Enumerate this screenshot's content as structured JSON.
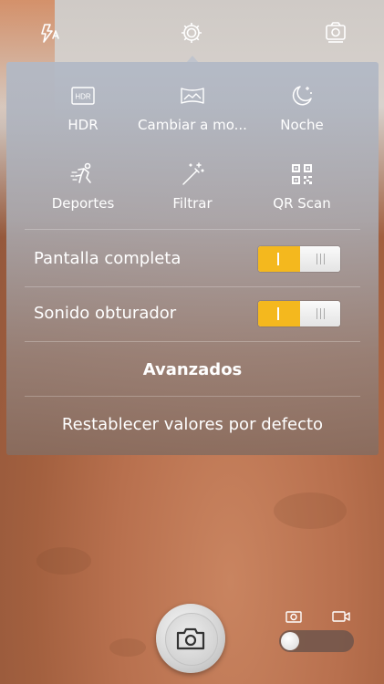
{
  "topbar": {
    "flash_icon": "flash-auto-icon",
    "settings_icon": "gear-icon",
    "switch_camera_icon": "switch-camera-icon"
  },
  "modes": [
    {
      "label": "HDR",
      "icon": "hdr-icon"
    },
    {
      "label": "Cambiar a mo...",
      "icon": "panorama-icon"
    },
    {
      "label": "Noche",
      "icon": "night-icon"
    },
    {
      "label": "Deportes",
      "icon": "sports-icon"
    },
    {
      "label": "Filtrar",
      "icon": "filter-wand-icon"
    },
    {
      "label": "QR Scan",
      "icon": "qr-code-icon"
    }
  ],
  "settings": {
    "fullscreen": {
      "label": "Pantalla completa",
      "on": true
    },
    "shutter_sound": {
      "label": "Sonido obturador",
      "on": true
    },
    "advanced_label": "Avanzados",
    "reset_label": "Restablecer valores por defecto"
  },
  "colors": {
    "toggle_on": "#f4b81e"
  },
  "bottom": {
    "shutter_icon": "camera-icon",
    "mode_photo_icon": "photo-mode-icon",
    "mode_video_icon": "video-mode-icon",
    "mode_selected": "photo"
  }
}
